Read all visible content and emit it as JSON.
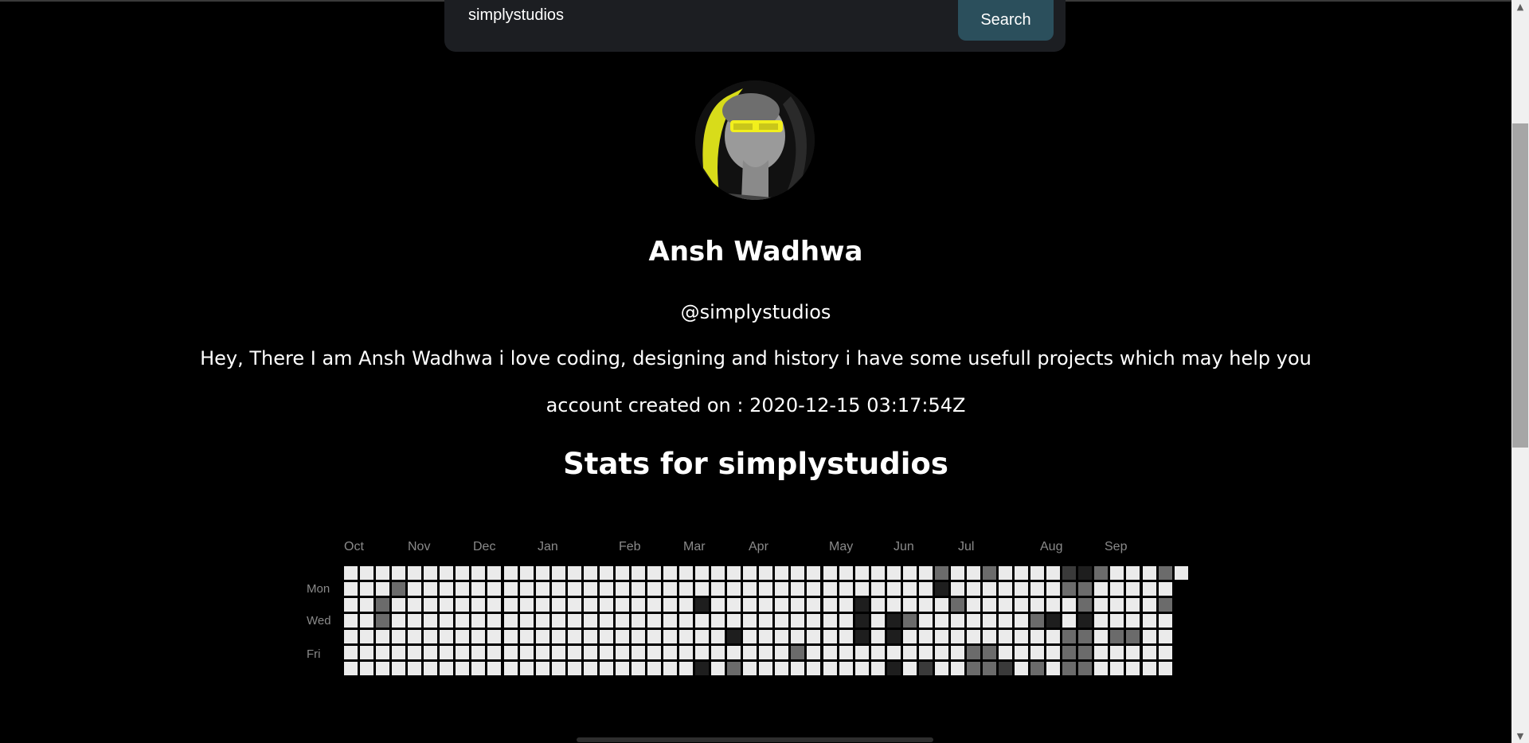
{
  "search": {
    "value": "simplystudios",
    "button_label": "Search"
  },
  "profile": {
    "name": "Ansh Wadhwa",
    "username": "@simplystudios",
    "bio": "Hey, There I am Ansh Wadhwa i love coding, designing and history i have some usefull projects which may help you",
    "created": "account created on : 2020-12-15 03:17:54Z"
  },
  "stats": {
    "title": "Stats for simplystudios"
  },
  "calendar": {
    "months": [
      "Oct",
      "Nov",
      "Dec",
      "Jan",
      "Feb",
      "Mar",
      "Apr",
      "May",
      "Jun",
      "Jul",
      "Aug",
      "Sep"
    ],
    "day_labels": [
      "Mon",
      "Wed",
      "Fri"
    ],
    "weeks": 53,
    "colors": {
      "empty": "#ebebeb",
      "level1": "#6b6b6b",
      "level2": "#3a3a3a",
      "level3": "#1e1e1e"
    },
    "active_cells": [
      [
        3,
        1,
        1
      ],
      [
        2,
        2,
        1
      ],
      [
        2,
        3,
        1
      ],
      [
        22,
        2,
        3
      ],
      [
        22,
        6,
        3
      ],
      [
        24,
        4,
        3
      ],
      [
        24,
        6,
        1
      ],
      [
        28,
        5,
        1
      ],
      [
        32,
        2,
        3
      ],
      [
        32,
        3,
        3
      ],
      [
        32,
        4,
        3
      ],
      [
        34,
        3,
        3
      ],
      [
        34,
        4,
        3
      ],
      [
        34,
        6,
        3
      ],
      [
        35,
        3,
        1
      ],
      [
        36,
        6,
        2
      ],
      [
        37,
        0,
        1
      ],
      [
        37,
        1,
        3
      ],
      [
        38,
        2,
        1
      ],
      [
        39,
        5,
        1
      ],
      [
        39,
        6,
        1
      ],
      [
        40,
        0,
        1
      ],
      [
        40,
        5,
        1
      ],
      [
        40,
        6,
        1
      ],
      [
        41,
        6,
        2
      ],
      [
        43,
        3,
        1
      ],
      [
        43,
        6,
        1
      ],
      [
        44,
        3,
        3
      ],
      [
        45,
        0,
        2
      ],
      [
        45,
        1,
        1
      ],
      [
        45,
        4,
        1
      ],
      [
        45,
        5,
        1
      ],
      [
        45,
        6,
        1
      ],
      [
        46,
        0,
        3
      ],
      [
        46,
        1,
        1
      ],
      [
        46,
        2,
        1
      ],
      [
        46,
        3,
        3
      ],
      [
        46,
        4,
        1
      ],
      [
        46,
        5,
        1
      ],
      [
        46,
        6,
        1
      ],
      [
        47,
        0,
        1
      ],
      [
        48,
        4,
        1
      ],
      [
        49,
        4,
        1
      ],
      [
        51,
        0,
        1
      ],
      [
        51,
        2,
        1
      ]
    ]
  }
}
